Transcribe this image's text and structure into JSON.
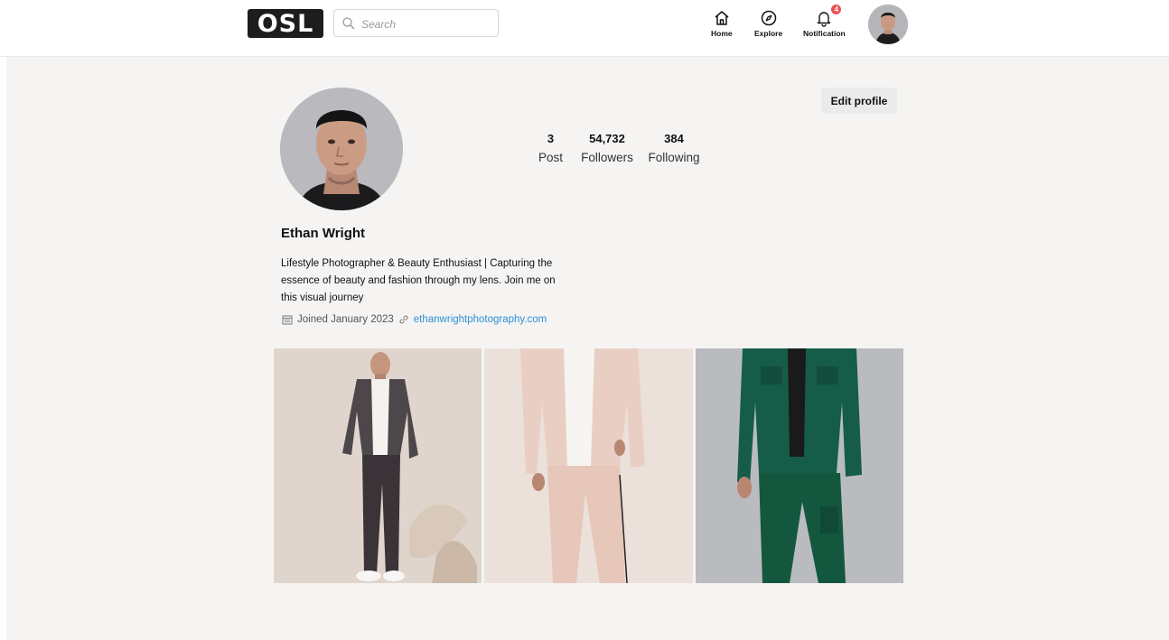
{
  "brand": {
    "logo_text": "OSL"
  },
  "search": {
    "placeholder": "Search"
  },
  "nav": {
    "home": "Home",
    "explore": "Explore",
    "notification": "Notification",
    "notification_count": "4"
  },
  "profile": {
    "name": "Ethan Wright",
    "edit_label": "Edit profile",
    "stats": [
      {
        "value": "3",
        "label": "Post"
      },
      {
        "value": "54,732",
        "label": "Followers"
      },
      {
        "value": "384",
        "label": "Following"
      }
    ],
    "bio_lines": [
      "Lifestyle Photographer & Beauty Enthusiast | Capturing the",
      "essence of beauty and fashion through my lens. Join me on",
      "this visual journey"
    ],
    "joined": "Joined January 2023",
    "website": "ethanwrightphotography.com"
  },
  "posts": [
    {
      "outfit": "charcoal suit, white tee"
    },
    {
      "outfit": "blush pink suit, white tee"
    },
    {
      "outfit": "green cargo set"
    }
  ],
  "colors": {
    "accent_link": "#2d8fd5",
    "badge": "#e9524f",
    "page_bg": "#f5f4f3"
  }
}
